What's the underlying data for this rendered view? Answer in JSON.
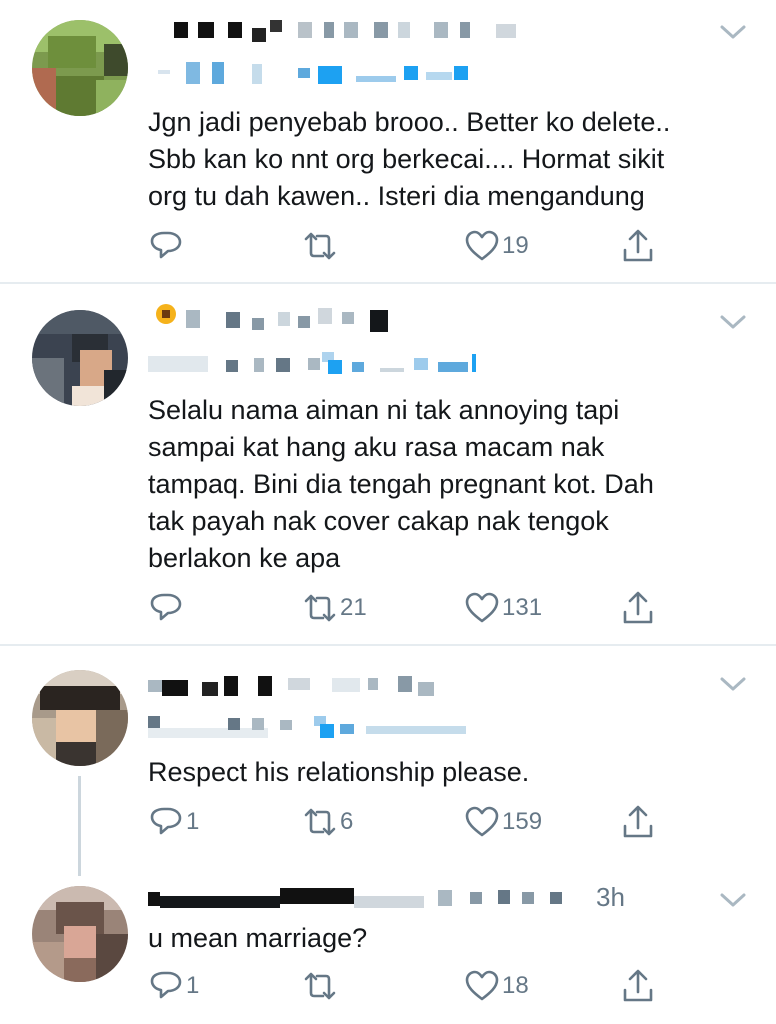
{
  "colors": {
    "icon": "#657786",
    "text": "#14171a",
    "divider": "#e6ecf0",
    "link": "#1da1f2"
  },
  "tweets": [
    {
      "text_lines": [
        "Jgn jadi penyebab brooo.. Better ko delete..",
        "Sbb kan ko nnt org berkecai.... Hormat sikit",
        "org tu dah kawen.. Isteri dia mengandung"
      ],
      "reply_count": "",
      "retweet_count": "",
      "like_count": "19"
    },
    {
      "text_lines": [
        "Selalu nama aiman ni tak annoying tapi",
        "sampai kat hang aku rasa macam nak",
        "tampaq. Bini dia tengah pregnant kot. Dah",
        "tak payah nak cover cakap nak tengok",
        "berlakon ke apa"
      ],
      "reply_count": "",
      "retweet_count": "21",
      "like_count": "131"
    },
    {
      "text_lines": [
        "Respect his relationship please."
      ],
      "reply_count": "1",
      "retweet_count": "6",
      "like_count": "159"
    },
    {
      "time": "3h",
      "text_lines": [
        "u mean marriage?"
      ],
      "reply_count": "1",
      "retweet_count": "",
      "like_count": "18"
    }
  ],
  "icons": {
    "reply": "reply-icon",
    "retweet": "retweet-icon",
    "like": "heart-icon",
    "share": "share-icon",
    "more": "chevron-down-icon"
  }
}
